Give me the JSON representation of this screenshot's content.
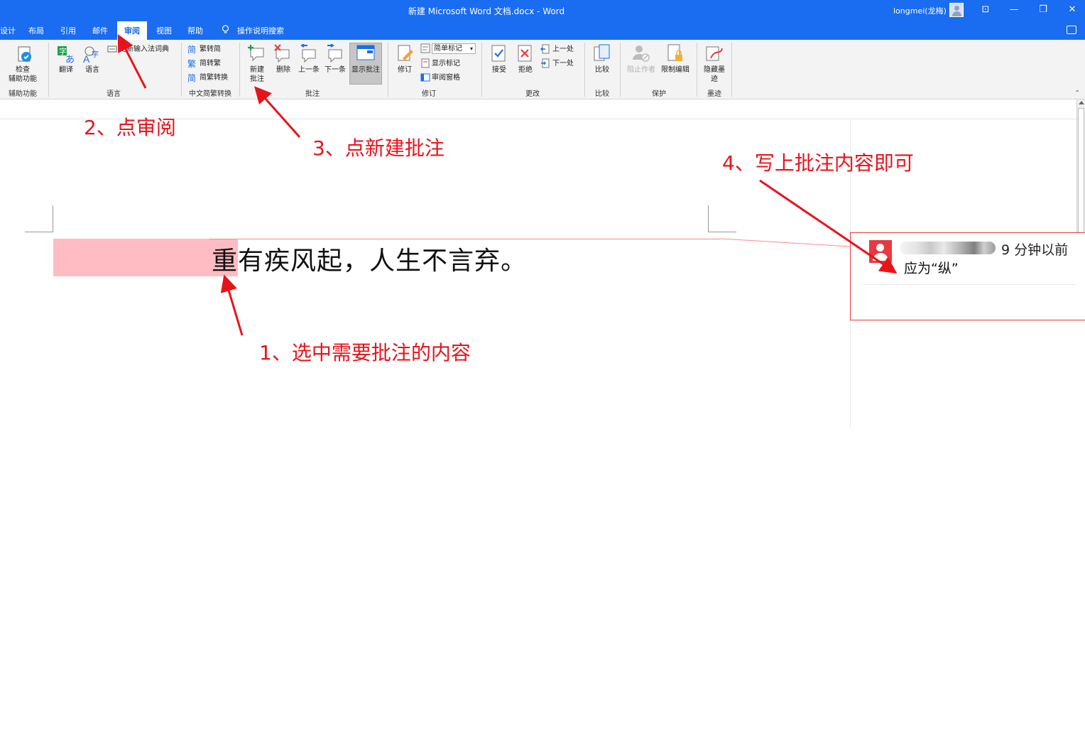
{
  "window": {
    "title": "新建 Microsoft Word 文档.docx  -  Word",
    "user": "longmei(龙梅)",
    "controls": [
      "⊡",
      "—",
      "❐",
      "✕"
    ]
  },
  "tabs": [
    {
      "label": "设计"
    },
    {
      "label": "布局"
    },
    {
      "label": "引用"
    },
    {
      "label": "邮件"
    },
    {
      "label": "审阅",
      "active": true
    },
    {
      "label": "视图"
    },
    {
      "label": "帮助"
    },
    {
      "label": "操作说明搜索"
    }
  ],
  "ribbon": {
    "accessibility": {
      "check_line1": "检查",
      "check_line2": "辅助功能",
      "group": "辅助功能"
    },
    "language": {
      "translate": "翻译",
      "language": "语言",
      "ime": "更新输入法词典",
      "group": "语言"
    },
    "chinese": {
      "t2s": "繁转简",
      "s2t": "简转繁",
      "convert": "简繁转换",
      "group": "中文简繁转换"
    },
    "comments": {
      "new_line1": "新建",
      "new_line2": "批注",
      "delete": "删除",
      "prev": "上一条",
      "next": "下一条",
      "show": "显示批注",
      "group": "批注"
    },
    "tracking": {
      "track": "修订",
      "markup": "简单标记",
      "show_markup": "显示标记",
      "pane": "审阅窗格",
      "group": "修订"
    },
    "changes": {
      "accept": "接受",
      "reject": "拒绝",
      "prev": "上一处",
      "next": "下一处",
      "group": "更改"
    },
    "compare": {
      "compare": "比较",
      "group": "比较"
    },
    "protect": {
      "block": "阻止作者",
      "restrict": "限制编辑",
      "group": "保护"
    },
    "ink": {
      "hide_line1": "隐藏墨",
      "hide_line2": "迹",
      "group": "墨迹"
    }
  },
  "document": {
    "text": "重有疾风起，人生不言弃。"
  },
  "comment": {
    "time": "9 分钟以前",
    "text": "应为“纵”"
  },
  "annotations": {
    "step1": "1、选中需要批注的内容",
    "step2": "2、点审阅",
    "step3": "3、点新建批注",
    "step4": "4、写上批注内容即可"
  },
  "colors": {
    "title_bar": "#1a6cf0",
    "annotation_red": "#e8131a",
    "selection": "#ffbcc2",
    "comment_border": "#e8393e"
  }
}
